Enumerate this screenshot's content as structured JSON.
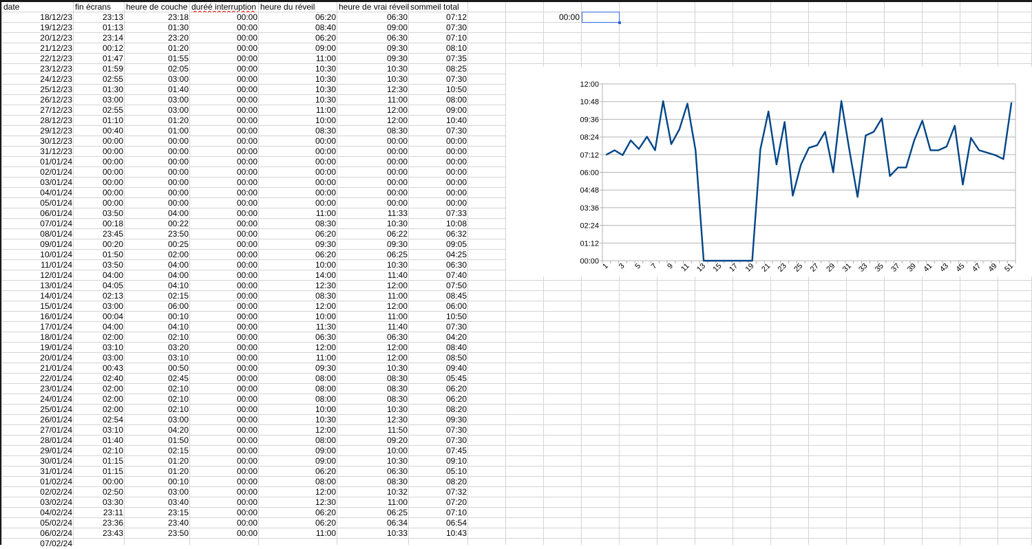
{
  "sheet": {
    "headers": [
      "date",
      "fin écrans",
      "heure de couche",
      "duréé interruption",
      "heure du réveil",
      "heure de vrai réveil",
      "sommeil total"
    ],
    "rows": [
      [
        "18/12/23",
        "23:13",
        "23:18",
        "00:00",
        "06:20",
        "06:30",
        "07:12"
      ],
      [
        "19/12/23",
        "01:13",
        "01:30",
        "00:00",
        "08:40",
        "09:00",
        "07:30"
      ],
      [
        "20/12/23",
        "23:14",
        "23:20",
        "00:00",
        "06:20",
        "06:30",
        "07:10"
      ],
      [
        "21/12/23",
        "00:12",
        "01:20",
        "00:00",
        "09:00",
        "09:30",
        "08:10"
      ],
      [
        "22/12/23",
        "01:47",
        "01:55",
        "00:00",
        "11:00",
        "09:30",
        "07:35"
      ],
      [
        "23/12/23",
        "01:59",
        "02:05",
        "00:00",
        "10:30",
        "10:30",
        "08:25"
      ],
      [
        "24/12/23",
        "02:55",
        "03:00",
        "00:00",
        "10:30",
        "10:30",
        "07:30"
      ],
      [
        "25/12/23",
        "01:30",
        "01:40",
        "00:00",
        "10:30",
        "12:30",
        "10:50"
      ],
      [
        "26/12/23",
        "03:00",
        "03:00",
        "00:00",
        "10:30",
        "11:00",
        "08:00"
      ],
      [
        "27/12/23",
        "02:55",
        "03:00",
        "00:00",
        "11:00",
        "12:00",
        "09:00"
      ],
      [
        "28/12/23",
        "01:10",
        "01:20",
        "00:00",
        "10:00",
        "12:00",
        "10:40"
      ],
      [
        "29/12/23",
        "00:40",
        "01:00",
        "00:00",
        "08:30",
        "08:30",
        "07:30"
      ],
      [
        "30/12/23",
        "00:00",
        "00:00",
        "00:00",
        "00:00",
        "00:00",
        "00:00"
      ],
      [
        "31/12/23",
        "00:00",
        "00:00",
        "00:00",
        "00:00",
        "00:00",
        "00:00"
      ],
      [
        "01/01/24",
        "00:00",
        "00:00",
        "00:00",
        "00:00",
        "00:00",
        "00:00"
      ],
      [
        "02/01/24",
        "00:00",
        "00:00",
        "00:00",
        "00:00",
        "00:00",
        "00:00"
      ],
      [
        "03/01/24",
        "00:00",
        "00:00",
        "00:00",
        "00:00",
        "00:00",
        "00:00"
      ],
      [
        "04/01/24",
        "00:00",
        "00:00",
        "00:00",
        "00:00",
        "00:00",
        "00:00"
      ],
      [
        "05/01/24",
        "00:00",
        "00:00",
        "00:00",
        "00:00",
        "00:00",
        "00:00"
      ],
      [
        "06/01/24",
        "03:50",
        "04:00",
        "00:00",
        "11:00",
        "11:33",
        "07:33"
      ],
      [
        "07/01/24",
        "00:18",
        "00:22",
        "00:00",
        "08:30",
        "10:30",
        "10:08"
      ],
      [
        "08/01/24",
        "23:45",
        "23:50",
        "00:00",
        "06:20",
        "06:22",
        "06:32"
      ],
      [
        "09/01/24",
        "00:20",
        "00:25",
        "00:00",
        "09:30",
        "09:30",
        "09:05"
      ],
      [
        "10/01/24",
        "01:50",
        "02:00",
        "00:00",
        "06:20",
        "06:25",
        "04:25"
      ],
      [
        "11/01/24",
        "03:50",
        "04:00",
        "00:00",
        "10:00",
        "10:30",
        "06:30"
      ],
      [
        "12/01/24",
        "04:00",
        "04:00",
        "00:00",
        "14:00",
        "11:40",
        "07:40"
      ],
      [
        "13/01/24",
        "04:05",
        "04:10",
        "00:00",
        "12:30",
        "12:00",
        "07:50"
      ],
      [
        "14/01/24",
        "02:13",
        "02:15",
        "00:00",
        "08:30",
        "11:00",
        "08:45"
      ],
      [
        "15/01/24",
        "03:00",
        "06:00",
        "00:00",
        "12:00",
        "12:00",
        "06:00"
      ],
      [
        "16/01/24",
        "00:04",
        "00:10",
        "00:00",
        "10:00",
        "11:00",
        "10:50"
      ],
      [
        "17/01/24",
        "04:00",
        "04:10",
        "00:00",
        "11:30",
        "11:40",
        "07:30"
      ],
      [
        "18/01/24",
        "02:00",
        "02:10",
        "00:00",
        "06:30",
        "06:30",
        "04:20"
      ],
      [
        "19/01/24",
        "03:10",
        "03:20",
        "00:00",
        "12:00",
        "12:00",
        "08:40"
      ],
      [
        "20/01/24",
        "03:00",
        "03:10",
        "00:00",
        "11:00",
        "12:00",
        "08:50"
      ],
      [
        "21/01/24",
        "00:43",
        "00:50",
        "00:00",
        "09:30",
        "10:30",
        "09:40"
      ],
      [
        "22/01/24",
        "02:40",
        "02:45",
        "00:00",
        "08:00",
        "08:30",
        "05:45"
      ],
      [
        "23/01/24",
        "02:00",
        "02:10",
        "00:00",
        "08:00",
        "08:30",
        "06:20"
      ],
      [
        "24/01/24",
        "02:00",
        "02:10",
        "00:00",
        "08:00",
        "08:30",
        "06:20"
      ],
      [
        "25/01/24",
        "02:00",
        "02:10",
        "00:00",
        "10:00",
        "10:30",
        "08:20"
      ],
      [
        "26/01/24",
        "02:54",
        "03:00",
        "00:00",
        "10:30",
        "12:30",
        "09:30"
      ],
      [
        "27/01/24",
        "03:10",
        "04:20",
        "00:00",
        "12:00",
        "11:50",
        "07:30"
      ],
      [
        "28/01/24",
        "01:40",
        "01:50",
        "00:00",
        "08:00",
        "09:20",
        "07:30"
      ],
      [
        "29/01/24",
        "02:10",
        "02:15",
        "00:00",
        "09:00",
        "10:00",
        "07:45"
      ],
      [
        "30/01/24",
        "01:15",
        "01:20",
        "00:00",
        "09:00",
        "10:30",
        "09:10"
      ],
      [
        "31/01/24",
        "01:15",
        "01:20",
        "00:00",
        "06:20",
        "06:30",
        "05:10"
      ],
      [
        "01/02/24",
        "00:00",
        "00:10",
        "00:00",
        "08:00",
        "08:30",
        "08:20"
      ],
      [
        "02/02/24",
        "02:50",
        "03:00",
        "00:00",
        "12:00",
        "10:32",
        "07:32"
      ],
      [
        "03/02/24",
        "03:30",
        "03:40",
        "00:00",
        "12:30",
        "11:00",
        "07:20"
      ],
      [
        "04/02/24",
        "23:11",
        "23:15",
        "00:00",
        "06:20",
        "06:25",
        "07:10"
      ],
      [
        "05/02/24",
        "23:36",
        "23:40",
        "00:00",
        "06:20",
        "06:34",
        "06:54"
      ],
      [
        "06/02/24",
        "23:43",
        "23:50",
        "00:00",
        "11:00",
        "10:33",
        "10:43"
      ],
      [
        "07/02/24",
        "",
        "",
        "",
        "",
        "",
        ""
      ]
    ],
    "lone_cell": "00:00"
  },
  "chart_data": {
    "type": "line",
    "series_color": "#004586",
    "y_ticks": [
      "00:00",
      "01:12",
      "02:24",
      "03:36",
      "04:48",
      "06:00",
      "07:12",
      "08:24",
      "09:36",
      "10:48",
      "12:00"
    ],
    "ylim_minutes": [
      0,
      720
    ],
    "x_tick_labels": [
      "1",
      "3",
      "5",
      "7",
      "9",
      "11",
      "13",
      "15",
      "17",
      "19",
      "21",
      "23",
      "25",
      "27",
      "29",
      "31",
      "33",
      "35",
      "37",
      "39",
      "41",
      "43",
      "45",
      "47",
      "49",
      "51"
    ],
    "x": [
      1,
      2,
      3,
      4,
      5,
      6,
      7,
      8,
      9,
      10,
      11,
      12,
      13,
      14,
      15,
      16,
      17,
      18,
      19,
      20,
      21,
      22,
      23,
      24,
      25,
      26,
      27,
      28,
      29,
      30,
      31,
      32,
      33,
      34,
      35,
      36,
      37,
      38,
      39,
      40,
      41,
      42,
      43,
      44,
      45,
      46,
      47,
      48,
      49,
      50,
      51
    ],
    "values_minutes": [
      432,
      450,
      430,
      490,
      455,
      505,
      450,
      650,
      475,
      535,
      640,
      450,
      0,
      0,
      0,
      0,
      0,
      0,
      0,
      453,
      608,
      392,
      565,
      265,
      390,
      460,
      470,
      525,
      360,
      650,
      450,
      260,
      510,
      525,
      580,
      345,
      380,
      380,
      490,
      570,
      450,
      450,
      465,
      550,
      310,
      500,
      450,
      440,
      430,
      414,
      643
    ],
    "grid": true,
    "legend": "none"
  }
}
